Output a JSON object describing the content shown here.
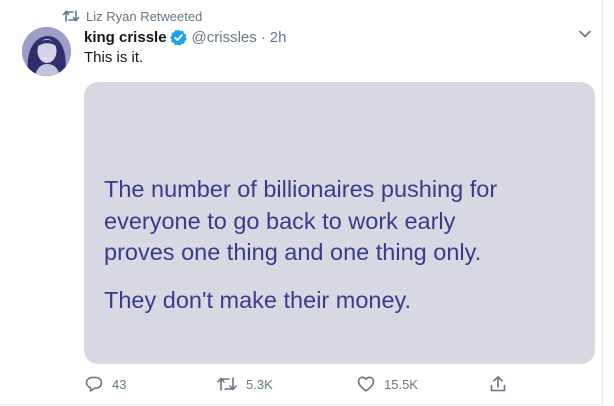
{
  "social_context": {
    "retweeter_text": "Liz Ryan Retweeted"
  },
  "author": {
    "display_name": "king crissle",
    "handle": "@crissles",
    "separator": "·",
    "time_ago": "2h",
    "verified": true
  },
  "tweet": {
    "text": "This is it."
  },
  "media": {
    "lines": [
      "The number of billionaires pushing for",
      "everyone to go back to work early",
      "proves one thing and one thing only.",
      "They don't make their money."
    ],
    "background_color": "#d8d8e2",
    "text_color": "#3a3b8f"
  },
  "actions": {
    "reply_count": "43",
    "retweet_count": "5.3K",
    "like_count": "15.5K"
  },
  "icons": {
    "retweet_context": "retweet-icon",
    "verified": "verified-badge-icon",
    "menu": "chevron-down-icon",
    "reply": "reply-icon",
    "retweet": "retweet-icon",
    "like": "heart-icon",
    "share": "share-icon"
  },
  "colors": {
    "text_primary": "#14171a",
    "text_secondary": "#657786",
    "verified_blue": "#1da1f2",
    "divider": "#e6ecf0"
  }
}
